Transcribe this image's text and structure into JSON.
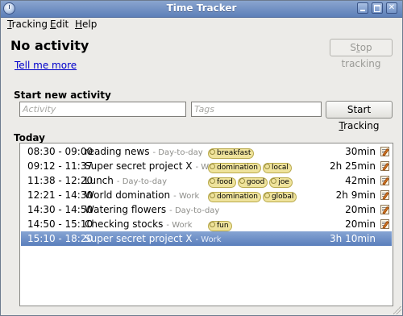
{
  "window": {
    "title": "Time Tracker"
  },
  "menu": {
    "tracking": {
      "underline": "T",
      "rest": "racking"
    },
    "edit": {
      "underline": "E",
      "rest": "dit"
    },
    "help": {
      "underline": "H",
      "rest": "elp"
    }
  },
  "status": {
    "title": "No activity",
    "tell_me_more": "Tell me more",
    "stop_button": {
      "pre": "S",
      "underline": "t",
      "rest": "op tracking"
    }
  },
  "new_activity": {
    "section_label": "Start new activity",
    "activity_placeholder": "Activity",
    "tags_placeholder": "Tags",
    "start_button": {
      "pre": "Start ",
      "underline": "T",
      "rest": "racking"
    }
  },
  "today": {
    "section_label": "Today",
    "rows": [
      {
        "time": "08:30 - 09:00",
        "name": "reading news",
        "category": "Day-to-day",
        "tags": [
          "breakfast"
        ],
        "duration": "30min",
        "selected": false
      },
      {
        "time": "09:12 - 11:37",
        "name": "Super secret project X",
        "category": "Work",
        "tags": [
          "domination",
          "local"
        ],
        "duration": "2h 25min",
        "selected": false
      },
      {
        "time": "11:38 - 12:20",
        "name": "Lunch",
        "category": "Day-to-day",
        "tags": [
          "food",
          "good",
          "joe"
        ],
        "duration": "42min",
        "selected": false
      },
      {
        "time": "12:21 - 14:30",
        "name": "World domination",
        "category": "Work",
        "tags": [
          "domination",
          "global"
        ],
        "duration": "2h 9min",
        "selected": false
      },
      {
        "time": "14:30 - 14:50",
        "name": "Watering flowers",
        "category": "Day-to-day",
        "tags": [],
        "duration": "20min",
        "selected": false
      },
      {
        "time": "14:50 - 15:10",
        "name": "Checking stocks",
        "category": "Work",
        "tags": [
          "fun"
        ],
        "duration": "20min",
        "selected": false
      },
      {
        "time": "15:10 - 18:20",
        "name": "Super secret project X",
        "category": "Work",
        "tags": [],
        "duration": "3h 10min",
        "selected": true
      }
    ]
  },
  "icons": {
    "app": "clock-icon",
    "minimize": "minimize-icon",
    "maximize": "maximize-icon",
    "close": "close-icon",
    "edit": "edit-icon",
    "tag": "tag-icon"
  },
  "colors": {
    "title_bar": "#5d7fb8",
    "selection": "#5a7fbc",
    "tag_background": "#efe39c",
    "link": "#0000cc"
  }
}
